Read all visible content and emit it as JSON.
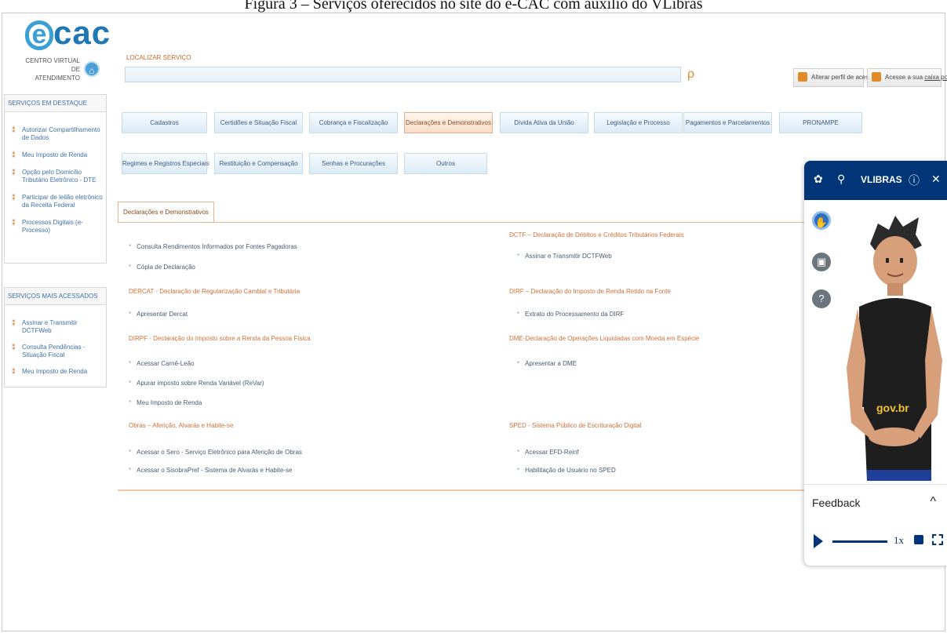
{
  "caption": "Figura 3 – Serviços oferecidos no site do e-CAC com auxílio do VLibras",
  "logo": {
    "brand_e": "e",
    "brand_cac": "cac",
    "subtitle_1": "CENTRO VIRTUAL",
    "subtitle_2": "DE ATENDIMENTO"
  },
  "search": {
    "label": "LOCALIZAR SERVIÇO",
    "value": "",
    "placeholder": ""
  },
  "top_buttons": {
    "profile": "Alterar perfil de acesso",
    "mailbox_prefix": "Acesse a sua ",
    "mailbox_link": "caixa postal"
  },
  "sidebar": {
    "highlight_title": "SERVIÇOS EM DESTAQUE",
    "highlight_items": [
      "Autorizar Compartilhamento de Dados",
      "Meu Imposto de Renda",
      "Opção pelo Domicílio Tributário Eletrônico - DTE",
      "Participar de leilão eletrônico da Receita Federal",
      "Processos Digitais (e-Processo)"
    ],
    "most_title": "SERVIÇOS MAIS ACESSADOS",
    "most_items": [
      "Assinar e Transmitir DCTFWeb",
      "Consulta Pendências - Situação Fiscal",
      "Meu Imposto de Renda"
    ]
  },
  "categories_row1": [
    "Cadastros",
    "Certidões e Situação Fiscal",
    "Cobrança e Fiscalização",
    "Declarações e Demonstrativos",
    "Dívida Ativa da União",
    "Legislação e Processo",
    "Pagamentos e Parcelamentos",
    "PRONAMPE"
  ],
  "categories_row2": [
    "Regimes e Registros Especiais",
    "Restituição e Compensação",
    "Senhas e Procurações",
    "Outros"
  ],
  "panel": {
    "tab": "Declarações e Demonstrativos",
    "left": {
      "top_links": [
        "Consulta Rendimentos Informados por Fontes Pagadoras",
        "Cópia de Declaração"
      ],
      "dercat_title": "DERCAT - Declaração de Regularização Cambial e Tributária",
      "dercat_links": [
        "Apresentar Dercat"
      ],
      "dirpf_title": "DIRPF - Declaração do Imposto sobre a Renda da Pessoa Física",
      "dirpf_links": [
        "Acessar Carnê-Leão",
        "Apurar imposto sobre Renda Variável (ReVar)",
        "Meu Imposto de Renda"
      ],
      "obras_title": "Obras – Aferição, Alvarás e Habite-se",
      "obras_links": [
        "Acessar o Sero - Serviço Eletrônico para Aferição de Obras",
        "Acessar o SisobraPref - Sistema de Alvarás e Habite-se"
      ]
    },
    "right": {
      "dctf_title": "DCTF – Declaração de Débitos e Créditos Tributários Federais",
      "dctf_links": [
        "Assinar e Transmitir DCTFWeb"
      ],
      "dirf_title": "DIRF – Declaração do Imposto de Renda Retido na Fonte",
      "dirf_links": [
        "Extrato do Processamento da DIRF"
      ],
      "dme_title": "DME-Declaração de Operações Liquidadas com Moeda em Espécie",
      "dme_links": [
        "Apresentar a DME"
      ],
      "sped_title": "SPED - Sistema Público de Escrituração Digital",
      "sped_links": [
        "Acessar EFD-Reinf",
        "Habilitação de Usuário no SPED"
      ]
    }
  },
  "vlibras": {
    "title": "VLIBRAS",
    "shirt_text": "gov.br",
    "feedback": "Feedback",
    "speed": "1x",
    "colors": {
      "bar": "#003577",
      "accent_orange": "#d0713a"
    }
  }
}
